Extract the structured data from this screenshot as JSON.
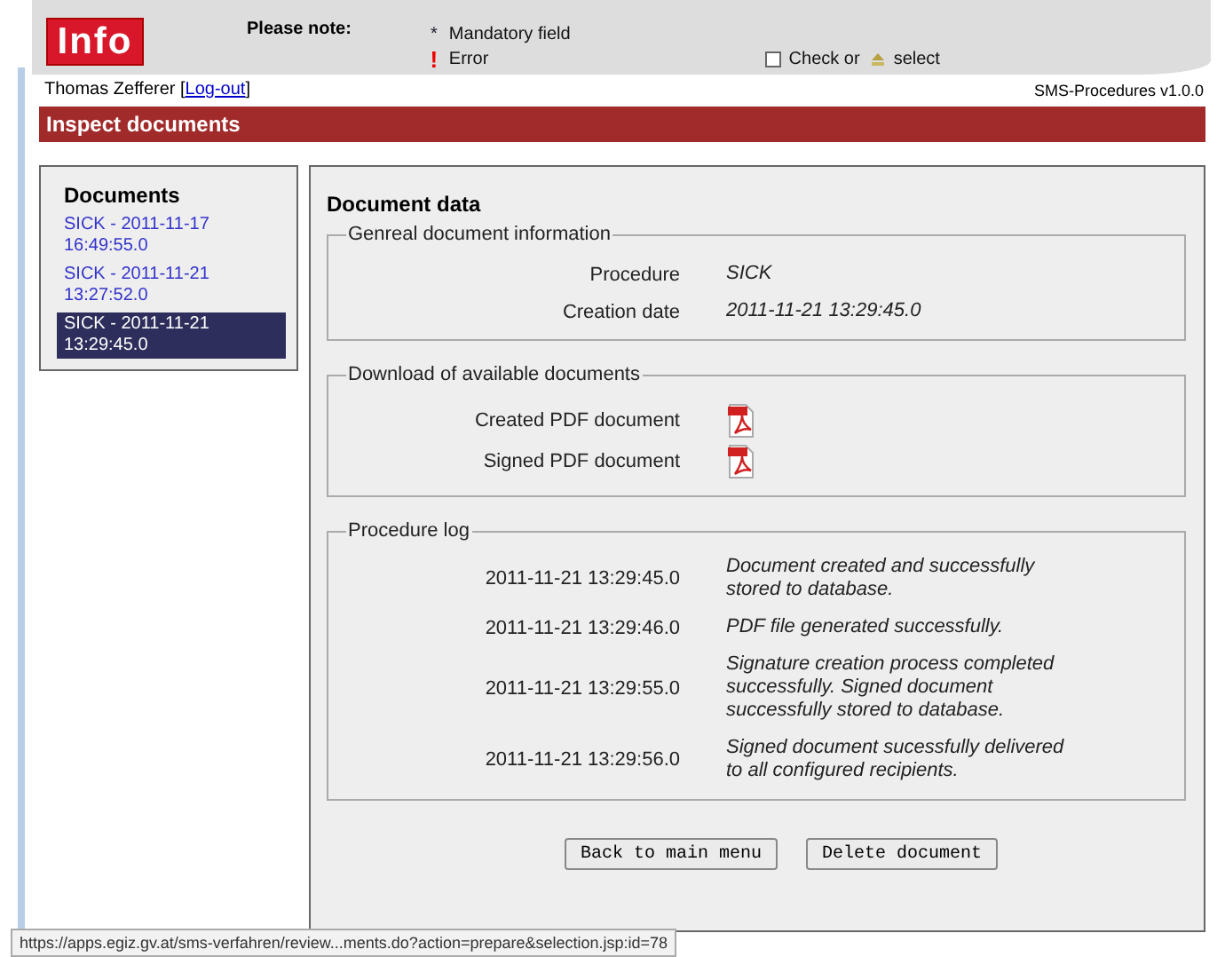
{
  "header": {
    "logo": "Info",
    "note_label": "Please note:",
    "legend": [
      {
        "kind": "mandatory",
        "symbol": "*",
        "label": "Mandatory field"
      },
      {
        "kind": "error",
        "symbol": "!",
        "label": "Error"
      },
      {
        "kind": "check",
        "label": "Check or"
      },
      {
        "kind": "select",
        "label": "select"
      }
    ]
  },
  "user": {
    "name": "Thomas Zefferer",
    "open": "[",
    "link": "Log-out",
    "close": "]"
  },
  "version": "SMS-Procedures v1.0.0",
  "title_bar": "Inspect documents",
  "sidebar": {
    "title": "Documents",
    "items": [
      {
        "label": "SICK - 2011-11-17\n16:49:55.0",
        "selected": false
      },
      {
        "label": "SICK - 2011-11-21\n13:27:52.0",
        "selected": false
      },
      {
        "label": "SICK - 2011-11-21\n13:29:45.0",
        "selected": true
      }
    ]
  },
  "main": {
    "title": "Document data",
    "sections": [
      {
        "kind": "info",
        "legend": "Genreal document information",
        "rows": [
          {
            "label": "Procedure",
            "value": "SICK"
          },
          {
            "label": "Creation date",
            "value": "2011-11-21 13:29:45.0"
          }
        ]
      },
      {
        "kind": "downloads",
        "legend": "Download of available documents",
        "rows": [
          {
            "label": "Created PDF document"
          },
          {
            "label": "Signed PDF document"
          }
        ]
      },
      {
        "kind": "log",
        "legend": "Procedure log",
        "rows": [
          {
            "label": "2011-11-21 13:29:45.0",
            "value": "Document created and successfully\nstored to database."
          },
          {
            "label": "2011-11-21 13:29:46.0",
            "value": "PDF file generated successfully."
          },
          {
            "label": "2011-11-21 13:29:55.0",
            "value": "Signature creation process completed\nsuccessfully. Signed document\nsuccessfully stored to database."
          },
          {
            "label": "2011-11-21 13:29:56.0",
            "value": "Signed document sucessfully delivered\nto all configured recipients."
          }
        ]
      }
    ],
    "buttons": [
      "Back to main menu",
      "Delete document"
    ]
  },
  "status_url": "https://apps.egiz.gv.at/sms-verfahren/review...ments.do?action=prepare&selection.jsp:id=78"
}
